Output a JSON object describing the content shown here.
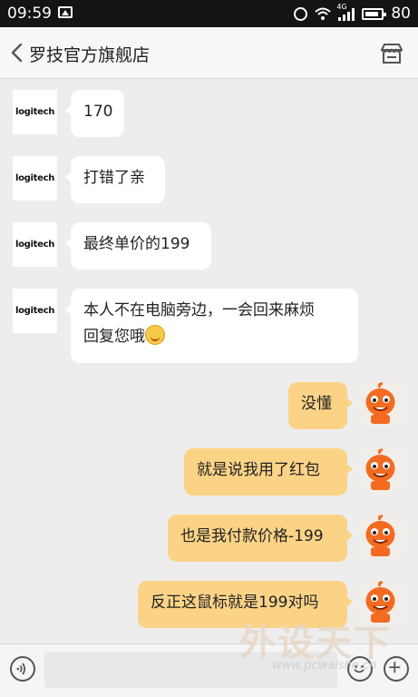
{
  "status_bar": {
    "time": "09:59",
    "network": "4G",
    "battery": "80"
  },
  "header": {
    "back_icon": "chevron-left-icon",
    "title": "罗技官方旗舰店",
    "shop_icon": "store-icon"
  },
  "messages": [
    {
      "from": "store",
      "avatar_text": "logitech",
      "text": "170"
    },
    {
      "from": "store",
      "avatar_text": "logitech",
      "text": "打错了亲"
    },
    {
      "from": "store",
      "avatar_text": "logitech",
      "text": "最终单价的199"
    },
    {
      "from": "store",
      "avatar_text": "logitech",
      "line1": "本人不在电脑旁边，一会回来麻烦",
      "line2": "回复您哦"
    },
    {
      "from": "user",
      "text": "没懂"
    },
    {
      "from": "user",
      "text": "就是说我用了红包"
    },
    {
      "from": "user",
      "text": "也是我付款价格-199"
    },
    {
      "from": "user",
      "text": "反正这鼠标就是199对吗"
    }
  ],
  "input_bar": {
    "voice_icon": "voice-icon",
    "input_value": "",
    "emoji_icon": "emoji-icon",
    "plus_icon": "plus-icon"
  },
  "watermark": {
    "title": "外设天下",
    "url": "www.pcwaishe.cn"
  },
  "colors": {
    "incoming_bubble": "#ffffff",
    "outgoing_bubble": "#fbd386",
    "background": "#ededed"
  }
}
